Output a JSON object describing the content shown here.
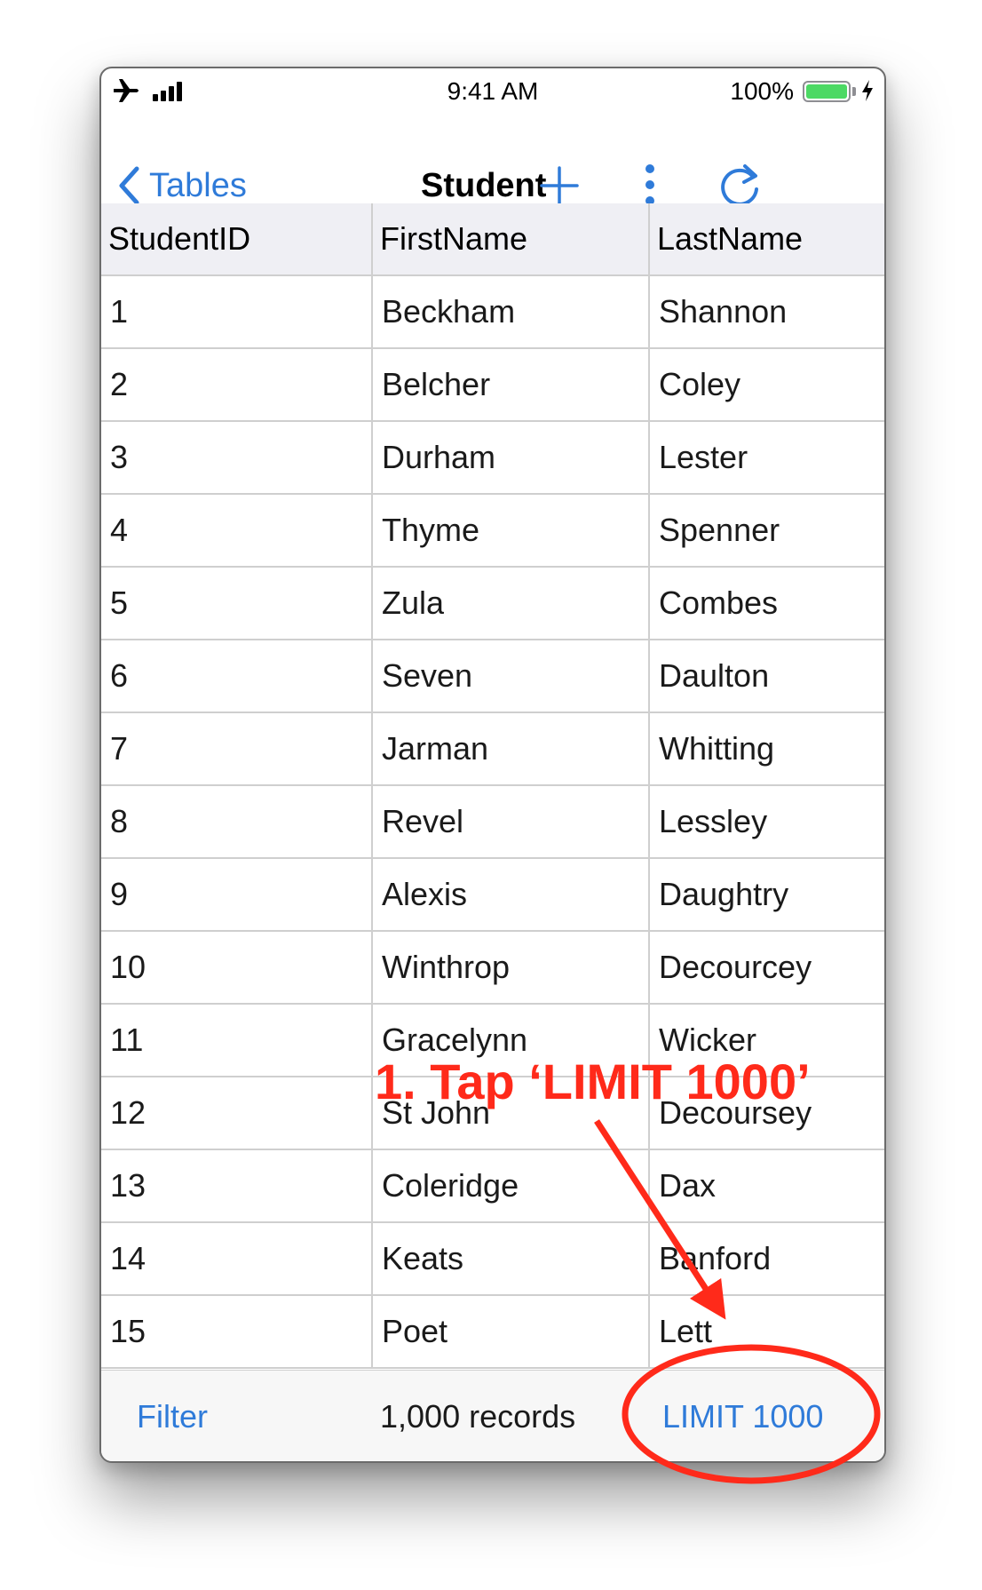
{
  "status_bar": {
    "time": "9:41 AM",
    "battery": "100%",
    "icons": [
      "airplane-icon",
      "signal-icon",
      "battery-icon",
      "charging-bolt-icon"
    ]
  },
  "nav": {
    "back_label": "Tables",
    "title": "Student",
    "buttons": [
      "plus-icon",
      "more-vertical-icon",
      "refresh-icon"
    ]
  },
  "table": {
    "columns": [
      "StudentID",
      "FirstName",
      "LastName"
    ],
    "rows": [
      [
        "1",
        "Beckham",
        "Shannon"
      ],
      [
        "2",
        "Belcher",
        "Coley"
      ],
      [
        "3",
        "Durham",
        "Lester"
      ],
      [
        "4",
        "Thyme",
        "Spenner"
      ],
      [
        "5",
        "Zula",
        "Combes"
      ],
      [
        "6",
        "Seven",
        "Daulton"
      ],
      [
        "7",
        "Jarman",
        "Whitting"
      ],
      [
        "8",
        "Revel",
        "Lessley"
      ],
      [
        "9",
        "Alexis",
        "Daughtry"
      ],
      [
        "10",
        "Winthrop",
        "Decourcey"
      ],
      [
        "11",
        "Gracelynn",
        "Wicker"
      ],
      [
        "12",
        "St John",
        "Decoursey"
      ],
      [
        "13",
        "Coleridge",
        "Dax"
      ],
      [
        "14",
        "Keats",
        "Banford"
      ],
      [
        "15",
        "Poet",
        "Lett"
      ]
    ]
  },
  "toolbar": {
    "filter_label": "Filter",
    "record_count": "1,000 records",
    "limit_label": "LIMIT 1000"
  },
  "annotation": {
    "text": "1. Tap ‘LIMIT 1000’"
  },
  "colors": {
    "accent": "#2f7bd9",
    "annotation": "#ff2a1a",
    "header_bg": "#efeff4",
    "battery": "#4cd964"
  }
}
